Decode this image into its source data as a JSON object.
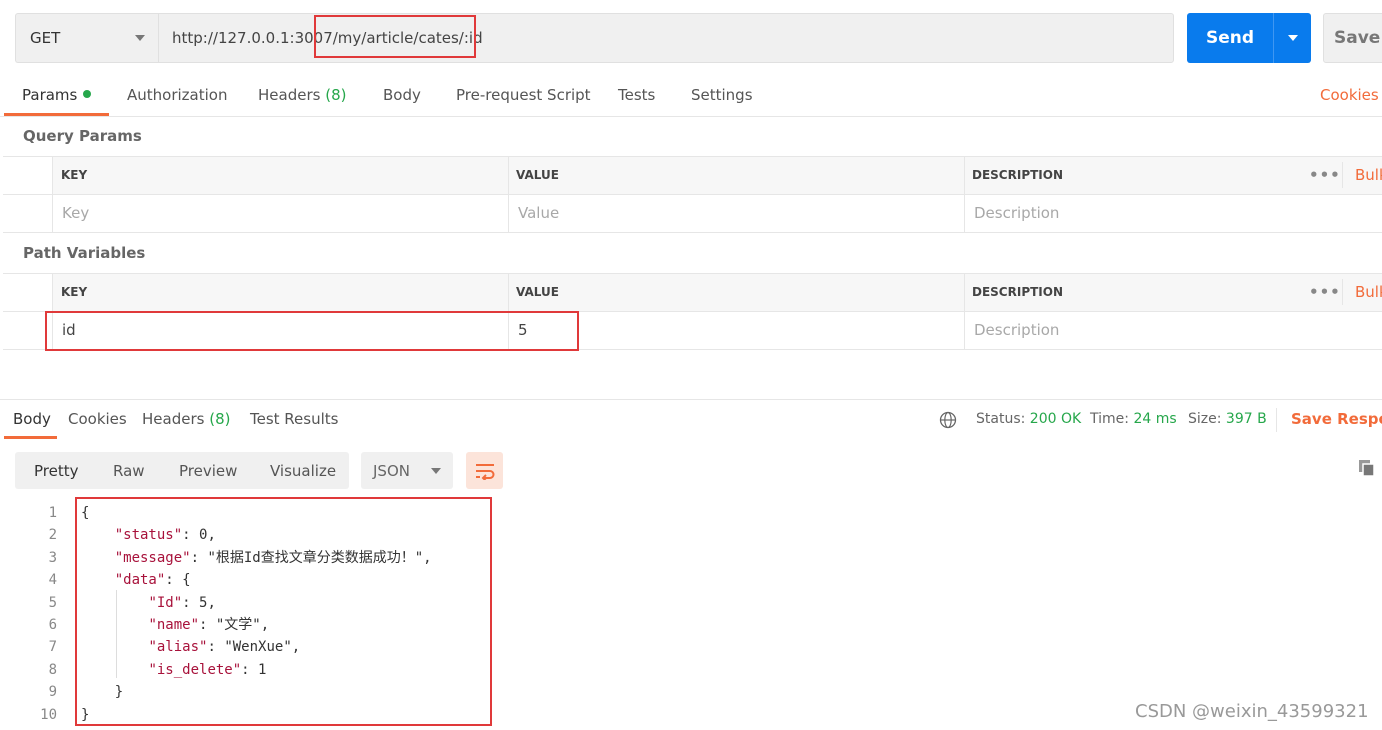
{
  "request": {
    "method": "GET",
    "url": "http://127.0.0.1:3007/my/article/cates/:id",
    "send_label": "Send",
    "save_label": "Save"
  },
  "request_tabs": {
    "params": "Params",
    "authorization": "Authorization",
    "headers": "Headers",
    "headers_count": "(8)",
    "body": "Body",
    "prerequest": "Pre-request Script",
    "tests": "Tests",
    "settings": "Settings",
    "cookies": "Cookies"
  },
  "query_params": {
    "title": "Query Params",
    "columns": [
      "KEY",
      "VALUE",
      "DESCRIPTION"
    ],
    "placeholders": {
      "key": "Key",
      "value": "Value",
      "description": "Description"
    },
    "more": "•••",
    "bulk": "Bulk"
  },
  "path_variables": {
    "title": "Path Variables",
    "columns": [
      "KEY",
      "VALUE",
      "DESCRIPTION"
    ],
    "rows": [
      {
        "key": "id",
        "value": "5"
      }
    ],
    "placeholders": {
      "description": "Description"
    },
    "more": "•••",
    "bulk": "Bulk"
  },
  "response_tabs": {
    "body": "Body",
    "cookies": "Cookies",
    "headers": "Headers",
    "headers_count": "(8)",
    "test_results": "Test Results"
  },
  "response_meta": {
    "status_label": "Status:",
    "status_value": "200 OK",
    "time_label": "Time:",
    "time_value": "24 ms",
    "size_label": "Size:",
    "size_value": "397 B",
    "save_response": "Save Respon"
  },
  "view_modes": [
    "Pretty",
    "Raw",
    "Preview",
    "Visualize"
  ],
  "format": "JSON",
  "response_body": {
    "line_numbers": [
      "1",
      "2",
      "3",
      "4",
      "5",
      "6",
      "7",
      "8",
      "9",
      "10"
    ],
    "lines": [
      "{",
      "    \"status\": 0,",
      "    \"message\": \"根据Id查找文章分类数据成功！\",",
      "    \"data\": {",
      "        \"Id\": 5,",
      "        \"name\": \"文学\",",
      "        \"alias\": \"WenXue\",",
      "        \"is_delete\": 1",
      "    }",
      "}"
    ]
  },
  "watermark": "CSDN @weixin_43599321",
  "colors": {
    "accent": "#f26b3a",
    "send": "#097bed",
    "success": "#26a74b",
    "highlight": "#e0393a"
  }
}
